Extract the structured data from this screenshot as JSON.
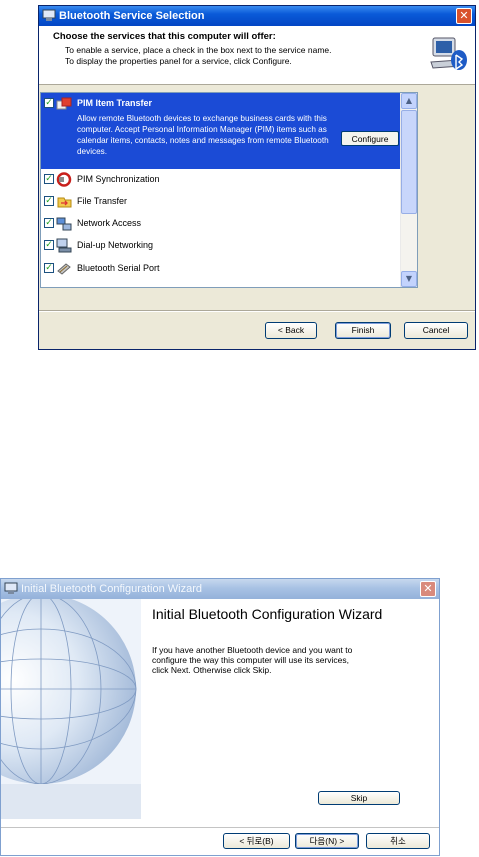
{
  "dialog1": {
    "title": "Bluetooth Service Selection",
    "header_title": "Choose the services that this computer will offer:",
    "header_line1": "To enable a service, place a check in the box next to the service name.",
    "header_line2": "To display the properties panel for a service, click Configure.",
    "services": [
      {
        "label": "PIM Item Transfer",
        "checked": true,
        "icon": "pim-transfer-icon",
        "selected": true
      },
      {
        "label": "PIM Synchronization",
        "checked": true,
        "icon": "pim-sync-icon"
      },
      {
        "label": "File Transfer",
        "checked": true,
        "icon": "file-transfer-icon"
      },
      {
        "label": "Network Access",
        "checked": true,
        "icon": "network-access-icon"
      },
      {
        "label": "Dial-up Networking",
        "checked": true,
        "icon": "dialup-icon"
      },
      {
        "label": "Bluetooth Serial Port",
        "checked": true,
        "icon": "serial-port-icon"
      }
    ],
    "selected_description": "Allow remote Bluetooth devices to exchange business cards with this computer. Accept Personal Information Manager (PIM) items such as calendar items, contacts, notes and messages from remote Bluetooth devices.",
    "configure_label": "Configure",
    "back_label": "< Back",
    "finish_label": "Finish",
    "cancel_label": "Cancel"
  },
  "dialog2": {
    "title": "Initial Bluetooth Configuration Wizard",
    "heading": "Initial Bluetooth Configuration Wizard",
    "body_line1": "If you have another Bluetooth device and you want to",
    "body_line2": "configure the way this computer will use its services,",
    "body_line3": "click Next. Otherwise click Skip.",
    "skip_label": "Skip",
    "back_label": "< 뒤로(B)",
    "next_label": "다음(N) >",
    "cancel_label": "취소"
  },
  "colors": {
    "titlebar": "#0a5ad8",
    "selection": "#1b4bd6",
    "dialog_bg": "#ece9d8"
  }
}
